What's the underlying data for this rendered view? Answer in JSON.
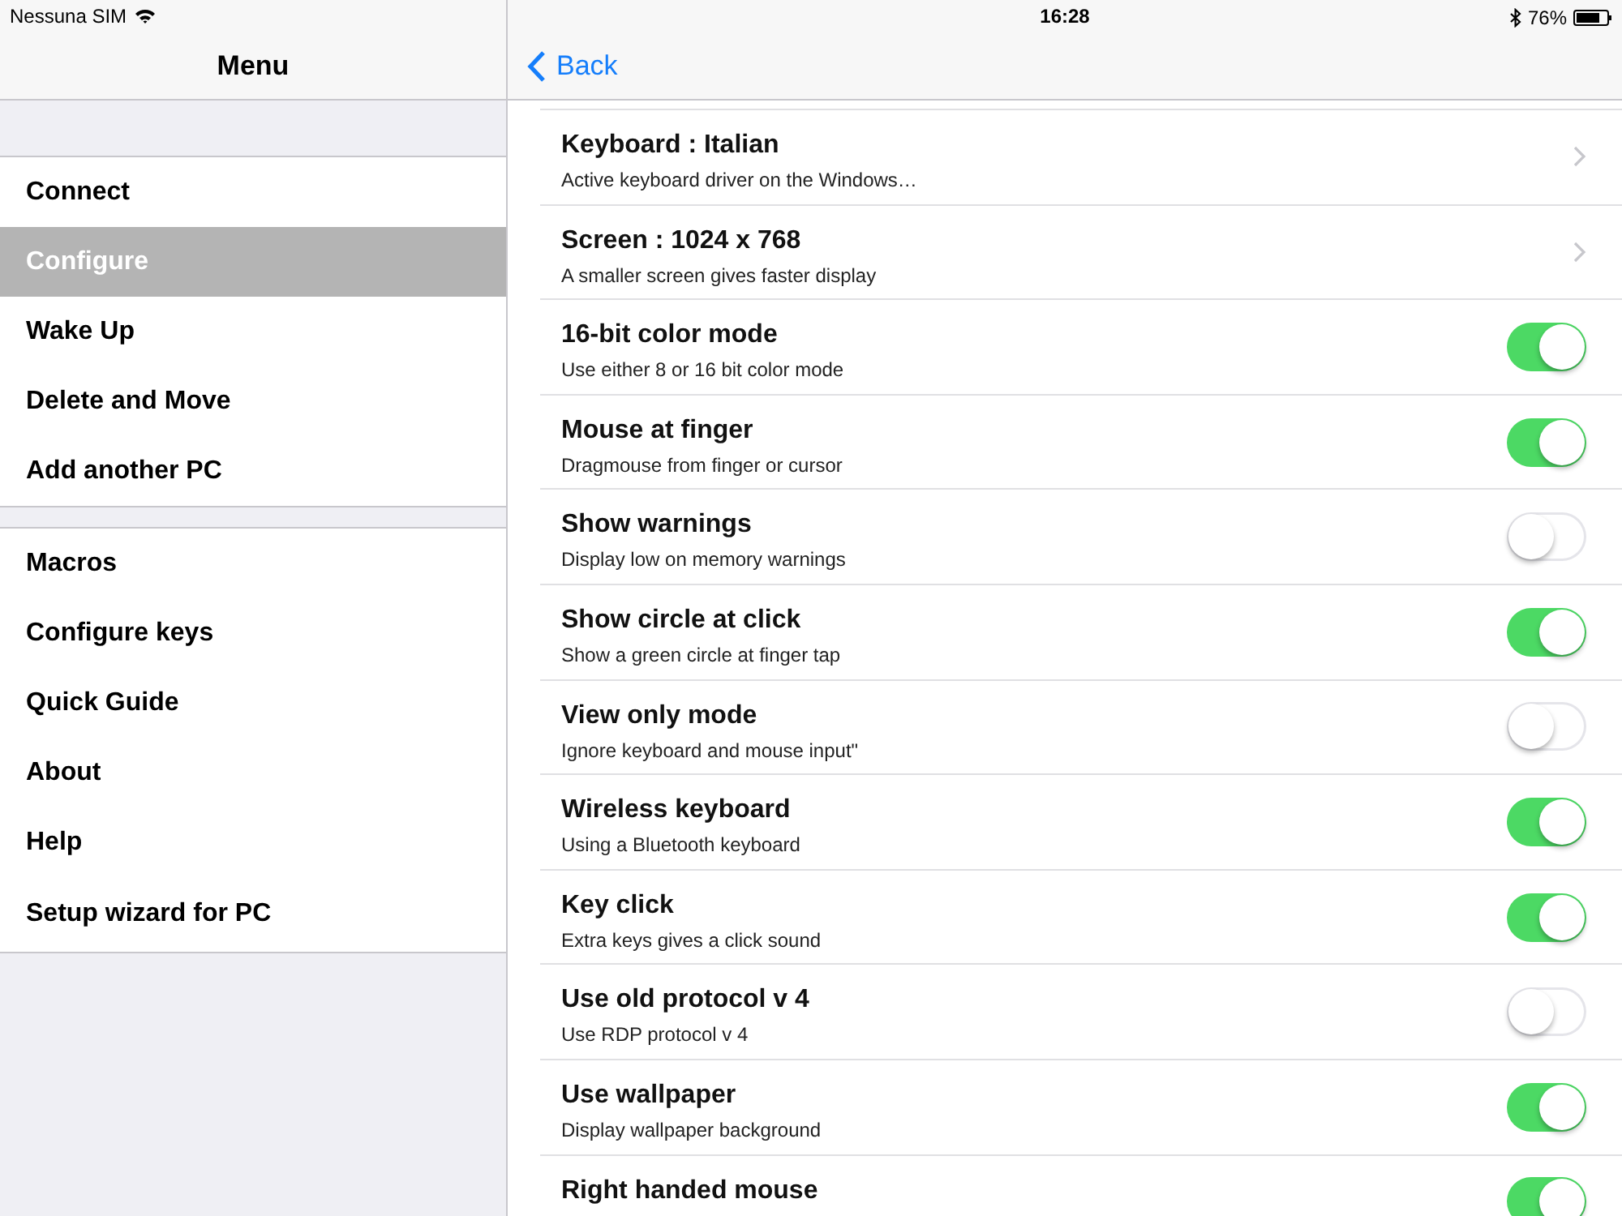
{
  "status_bar": {
    "carrier": "Nessuna SIM",
    "time": "16:28",
    "battery": "76%"
  },
  "menu": {
    "title": "Menu",
    "groups": [
      [
        {
          "label": "Connect",
          "selected": false
        },
        {
          "label": "Configure",
          "selected": true
        },
        {
          "label": "Wake Up",
          "selected": false
        },
        {
          "label": "Delete and Move",
          "selected": false
        },
        {
          "label": "Add another PC",
          "selected": false
        }
      ],
      [
        {
          "label": "Macros",
          "selected": false
        },
        {
          "label": "Configure keys",
          "selected": false
        },
        {
          "label": "Quick Guide",
          "selected": false
        },
        {
          "label": "About",
          "selected": false
        },
        {
          "label": "Help",
          "selected": false
        },
        {
          "label": "Setup wizard for PC",
          "selected": false
        }
      ]
    ]
  },
  "detail": {
    "back": "Back",
    "settings": [
      {
        "kind": "link",
        "title": "Keyboard : Italian",
        "subtitle": "Active keyboard driver on the Windows…"
      },
      {
        "kind": "link",
        "title": "Screen : 1024 x 768",
        "subtitle": "A smaller screen gives faster display"
      },
      {
        "kind": "toggle",
        "title": "16-bit color mode",
        "subtitle": "Use either 8 or 16 bit color mode",
        "on": true
      },
      {
        "kind": "toggle",
        "title": "Mouse at finger",
        "subtitle": "Dragmouse from finger or cursor",
        "on": true
      },
      {
        "kind": "toggle",
        "title": "Show warnings",
        "subtitle": "Display low on memory warnings",
        "on": false
      },
      {
        "kind": "toggle",
        "title": "Show circle at click",
        "subtitle": "Show a green circle at finger tap",
        "on": true
      },
      {
        "kind": "toggle",
        "title": "View only mode",
        "subtitle": "Ignore keyboard and mouse input\"",
        "on": false
      },
      {
        "kind": "toggle",
        "title": "Wireless keyboard",
        "subtitle": "Using a Bluetooth keyboard",
        "on": true
      },
      {
        "kind": "toggle",
        "title": "Key click",
        "subtitle": "Extra keys gives a click sound",
        "on": true
      },
      {
        "kind": "toggle",
        "title": "Use old protocol v 4",
        "subtitle": "Use RDP protocol v 4",
        "on": false
      },
      {
        "kind": "toggle",
        "title": "Use wallpaper",
        "subtitle": "Display wallpaper background",
        "on": true
      },
      {
        "kind": "toggle",
        "title": "Right handed mouse",
        "on": true
      }
    ]
  }
}
